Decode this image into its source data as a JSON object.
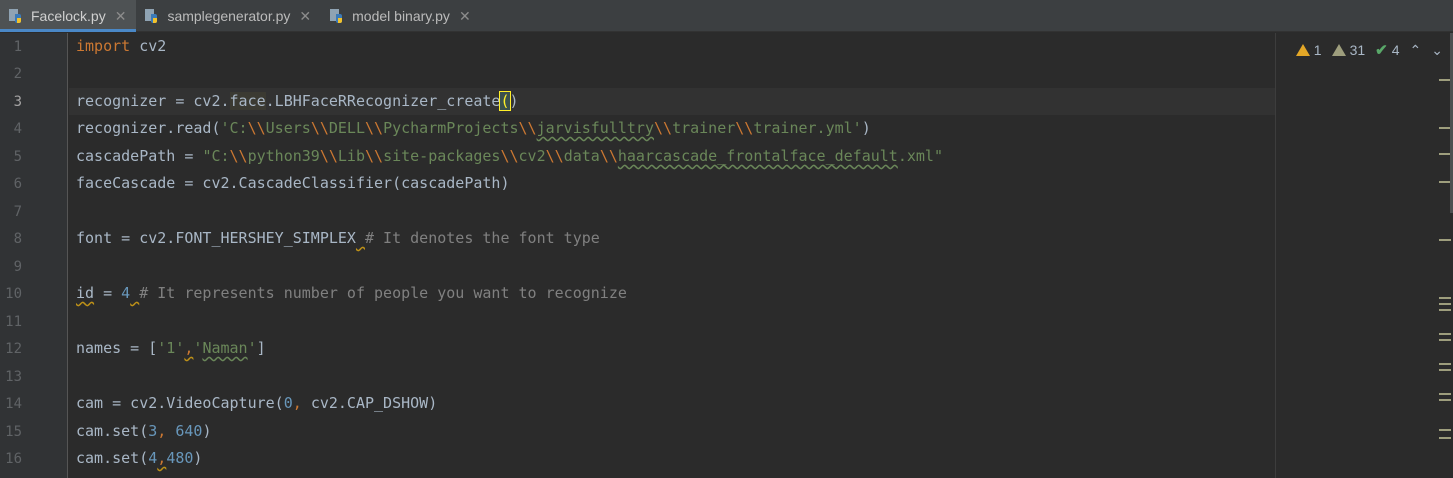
{
  "tabs": [
    {
      "label": "Facelock.py",
      "active": true
    },
    {
      "label": "samplegenerator.py",
      "active": false
    },
    {
      "label": "model binary.py",
      "active": false
    }
  ],
  "inspections": {
    "errors": "1",
    "warnings": "31",
    "weak": "4"
  },
  "line_numbers": [
    "1",
    "2",
    "3",
    "4",
    "5",
    "6",
    "7",
    "8",
    "9",
    "10",
    "11",
    "12",
    "13",
    "14",
    "15",
    "16"
  ],
  "current_line": "3",
  "code": {
    "l1_kw": "import",
    "l1_rest": " cv2",
    "l3_a": "recognizer = cv2.",
    "l3_face": "face",
    "l3_b": ".LBHFaceRRecognizer_create",
    "l3_open": "(",
    "l3_close": ")",
    "l4_a": "recognizer.read(",
    "l4_s1": "'C:",
    "l4_e1": "\\\\",
    "l4_s2": "Users",
    "l4_e2": "\\\\",
    "l4_s3": "DELL",
    "l4_e3": "\\\\",
    "l4_s4": "PycharmProjects",
    "l4_e4": "\\\\",
    "l4_s5": "jarvisfulltry",
    "l4_e5": "\\\\",
    "l4_s6": "trainer",
    "l4_e6": "\\\\",
    "l4_s7": "trainer.yml'",
    "l4_b": ")",
    "l5_a": "cascadePath = ",
    "l5_s1": "\"C:",
    "l5_e1": "\\\\",
    "l5_s2": "python39",
    "l5_e2": "\\\\",
    "l5_s3": "Lib",
    "l5_e3": "\\\\",
    "l5_s4": "site-packages",
    "l5_e4": "\\\\",
    "l5_s5": "cv2",
    "l5_e5": "\\\\",
    "l5_s6": "data",
    "l5_e6": "\\\\",
    "l5_s7": "haarcascade_frontalface_default",
    "l5_s8": ".xml\"",
    "l6": "faceCascade = cv2.CascadeClassifier(cascadePath)",
    "l8_a": "font = cv2.FONT_HERSHEY_SIMPLEX",
    "l8_sp": " ",
    "l8_com": "# It denotes the font type",
    "l10_id": "id",
    "l10_a": " = ",
    "l10_num": "4",
    "l10_sp": " ",
    "l10_com": "# It represents number of people you want to recognize",
    "l12_a": "names = [",
    "l12_s1": "'1'",
    "l12_comma": ",",
    "l12_s2a": "'",
    "l12_s2b": "Naman",
    "l12_s2c": "'",
    "l12_b": "]",
    "l14_a": "cam = cv2.VideoCapture(",
    "l14_num": "0",
    "l14_comma": ", ",
    "l14_b": "cv2.CAP_DSHOW)",
    "l15_a": "cam.set(",
    "l15_n1": "3",
    "l15_comma": ", ",
    "l15_n2": "640",
    "l15_b": ")",
    "l16_a": "cam.set(",
    "l16_n1": "4",
    "l16_comma": ",",
    "l16_n2": "480",
    "l16_b": ")"
  },
  "colors": {
    "accent": "#4a88c7",
    "keyword": "#cc7832",
    "string": "#6a8759",
    "number": "#6897bb",
    "comment": "#808080"
  }
}
